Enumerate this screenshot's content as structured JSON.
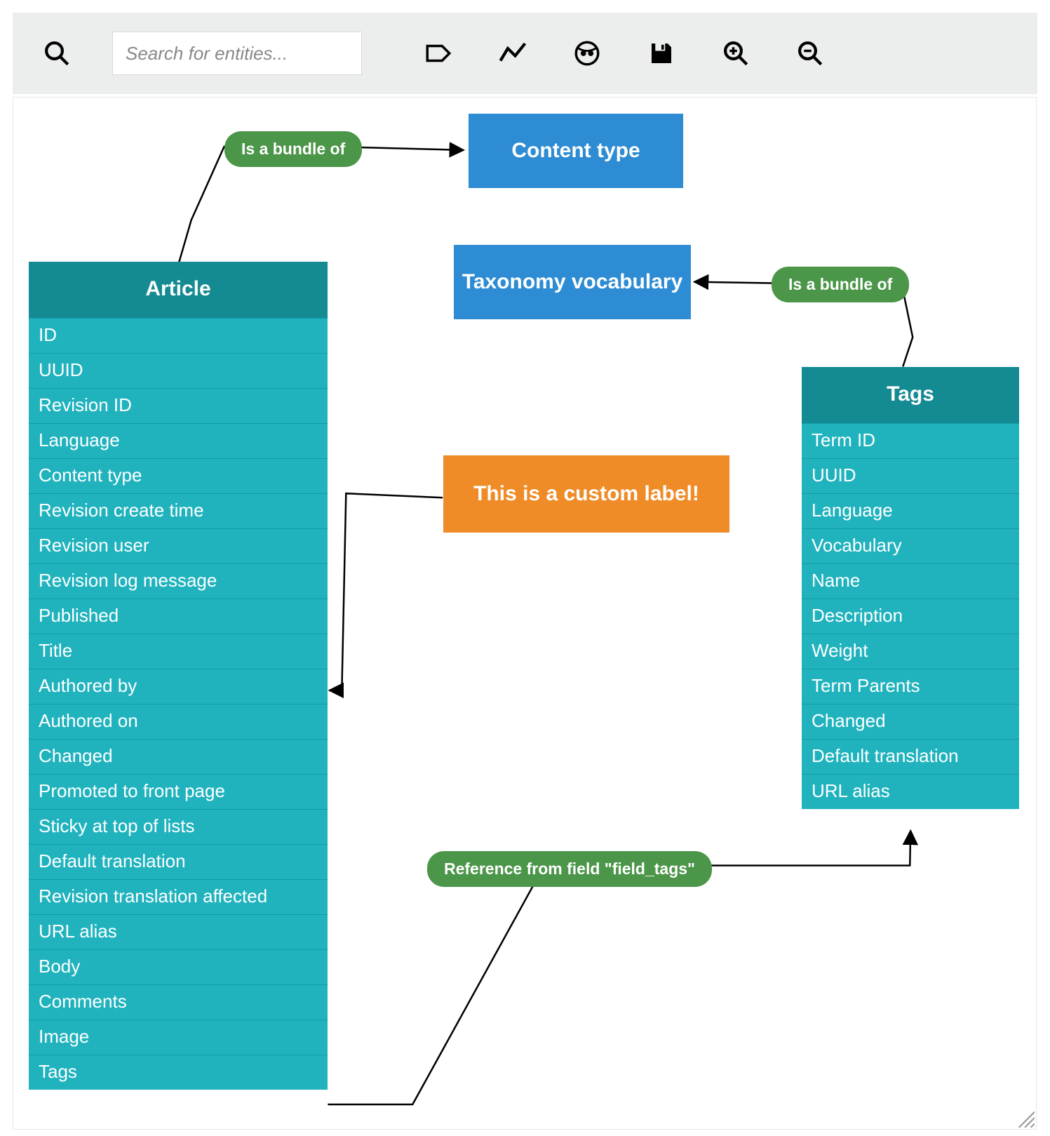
{
  "toolbar": {
    "search_placeholder": "Search for entities..."
  },
  "nodes": {
    "content_type": {
      "label": "Content type"
    },
    "taxonomy_vocabulary": {
      "label": "Taxonomy vocabulary"
    },
    "custom_label": {
      "label": "This is a custom label!"
    },
    "article": {
      "title": "Article",
      "fields": [
        "ID",
        "UUID",
        "Revision ID",
        "Language",
        "Content type",
        "Revision create time",
        "Revision user",
        "Revision log message",
        "Published",
        "Title",
        "Authored by",
        "Authored on",
        "Changed",
        "Promoted to front page",
        "Sticky at top of lists",
        "Default translation",
        "Revision translation affected",
        "URL alias",
        "Body",
        "Comments",
        "Image",
        "Tags"
      ]
    },
    "tags": {
      "title": "Tags",
      "fields": [
        "Term ID",
        "UUID",
        "Language",
        "Vocabulary",
        "Name",
        "Description",
        "Weight",
        "Term Parents",
        "Changed",
        "Default translation",
        "URL alias"
      ]
    }
  },
  "edges": {
    "article_bundle": {
      "label": "Is a bundle of"
    },
    "tags_bundle": {
      "label": "Is a bundle of"
    },
    "custom": {
      "label": "This is a custom label!"
    },
    "reference": {
      "label": "Reference from field \"field_tags\""
    }
  }
}
